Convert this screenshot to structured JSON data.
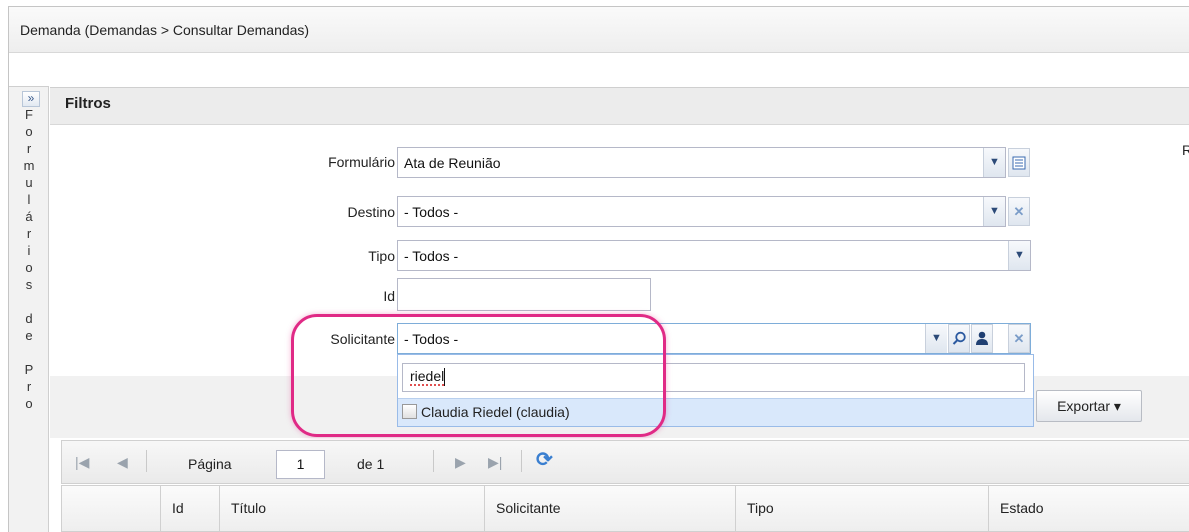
{
  "page_title": "Demanda  (Demandas > Consultar Demandas)",
  "sidebar": {
    "expand_glyph": "»",
    "vertical_text": "F\no\nr\nm\nu\nl\ná\nr\ni\no\ns\n\nd\ne\n\nP\nr\no"
  },
  "filters": {
    "title": "Filtros",
    "formulario": {
      "label": "Formulário",
      "value": "Ata de Reunião"
    },
    "destino": {
      "label": "Destino",
      "value": "- Todos -"
    },
    "tipo": {
      "label": "Tipo",
      "value": "- Todos -"
    },
    "id": {
      "label": "Id",
      "value": ""
    },
    "solicitante": {
      "label": "Solicitante",
      "value": "- Todos -"
    },
    "right_letter": "R"
  },
  "dropdown": {
    "search_text": "riedel",
    "items": [
      {
        "label": "Claudia Riedel (claudia)",
        "checked": false
      }
    ]
  },
  "toolbar": {
    "export_label": "Exportar ▾"
  },
  "pager": {
    "page_label": "Página",
    "page_value": "1",
    "of_label": "de 1"
  },
  "grid": {
    "columns": [
      "Id",
      "Título",
      "Solicitante",
      "Tipo",
      "Estado"
    ]
  },
  "icons": {
    "chevron_down": "chevron-down-icon",
    "list": "list-icon",
    "clear": "clear-icon",
    "search": "search-icon",
    "user": "user-icon",
    "first_page": "first-page-icon",
    "prev_page": "prev-page-icon",
    "next_page": "next-page-icon",
    "last_page": "last-page-icon",
    "refresh": "refresh-icon"
  },
  "colors": {
    "highlight": "#e02a86",
    "selected_item": "#d9e8fb",
    "accent": "#2c4a78"
  }
}
